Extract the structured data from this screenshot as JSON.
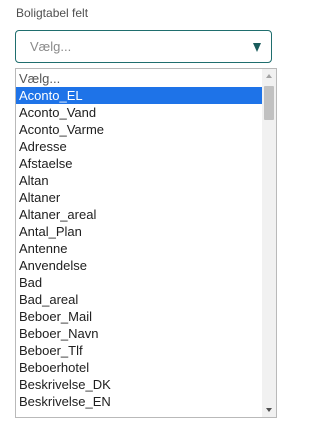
{
  "field": {
    "label": "Boligtabel felt",
    "value": "Vælg..."
  },
  "dropdown": {
    "selected_index": 1,
    "options": [
      "Vælg...",
      "Aconto_EL",
      "Aconto_Vand",
      "Aconto_Varme",
      "Adresse",
      "Afstaelse",
      "Altan",
      "Altaner",
      "Altaner_areal",
      "Antal_Plan",
      "Antenne",
      "Anvendelse",
      "Bad",
      "Bad_areal",
      "Beboer_Mail",
      "Beboer_Navn",
      "Beboer_Tlf",
      "Beboerhotel",
      "Beskrivelse_DK",
      "Beskrivelse_EN"
    ],
    "scroll_position": 0.0
  },
  "colors": {
    "accent": "#1f6e6e",
    "caret": "#1a5c5c",
    "selected_bg": "#1e73e8",
    "selected_fg": "#ffffff"
  },
  "icons": {
    "caret": "triangle-down-icon",
    "scroll_up": "scroll-up-arrow-icon",
    "scroll_down": "scroll-down-arrow-icon"
  }
}
